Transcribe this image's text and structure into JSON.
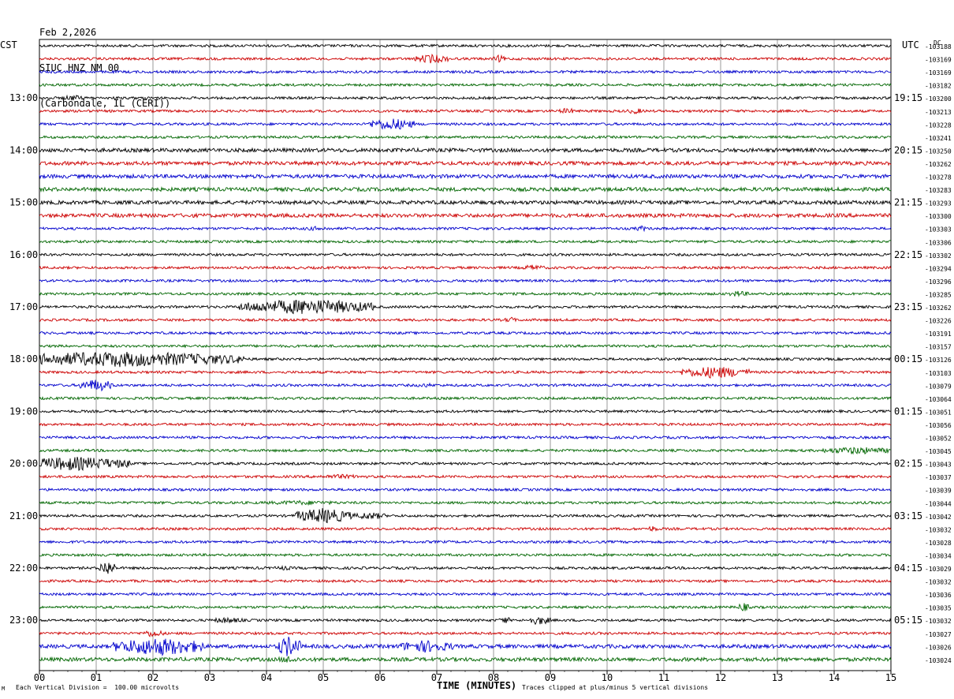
{
  "header": {
    "date": "Feb 2,2026",
    "station": "SIUC HNZ NM 00",
    "location": "(Carbondale, IL (CERI))"
  },
  "left_tz": "CST",
  "right_tz": "UTC",
  "dc_label": "DC",
  "footer": {
    "left": "Each Vertical Division =  100.00 microvolts",
    "xlabel": "TIME (MINUTES)",
    "right": "Traces clipped at plus/minus 5 vertical divisions",
    "corner": "M"
  },
  "colors": {
    "trace_cycle": [
      "#000000",
      "#cc0000",
      "#0000cc",
      "#006600"
    ],
    "grid": "#000000"
  },
  "chart_data": {
    "type": "line",
    "xlabel": "TIME (MINUTES)",
    "xlim": [
      0,
      15
    ],
    "x_ticks": [
      "00",
      "01",
      "02",
      "03",
      "04",
      "05",
      "06",
      "07",
      "08",
      "09",
      "10",
      "11",
      "12",
      "13",
      "14",
      "15"
    ],
    "left_hour_labels": [
      "13:00",
      "14:00",
      "15:00",
      "16:00",
      "17:00",
      "18:00",
      "19:00",
      "20:00",
      "21:00",
      "22:00",
      "23:00"
    ],
    "right_hour_labels": [
      "19:15",
      "20:15",
      "21:15",
      "22:15",
      "23:15",
      "00:15",
      "01:15",
      "02:15",
      "03:15",
      "04:15",
      "05:15"
    ],
    "dc_offsets": [
      "-103188",
      "-103169",
      "-103169",
      "-103182",
      "-103200",
      "-103213",
      "-103228",
      "-103241",
      "-103250",
      "-103262",
      "-103278",
      "-103283",
      "-103293",
      "-103300",
      "-103303",
      "-103306",
      "-103302",
      "-103294",
      "-103296",
      "-103285",
      "-103262",
      "-103226",
      "-103191",
      "-103157",
      "-103126",
      "-103103",
      "-103079",
      "-103064",
      "-103051",
      "-103056",
      "-103052",
      "-103045",
      "-103043",
      "-103037",
      "-103039",
      "-103044",
      "-103042",
      "-103032",
      "-103028",
      "-103034",
      "-103029",
      "-103032",
      "-103036",
      "-103035",
      "-103032",
      "-103027",
      "-103026",
      "-103024"
    ],
    "noise_level": [
      2,
      2,
      2,
      2,
      2,
      2,
      2,
      2,
      3,
      3,
      3,
      3,
      3,
      3,
      2,
      2,
      2,
      2,
      2,
      2,
      2,
      2,
      2,
      2,
      2,
      2,
      2,
      2,
      2,
      2,
      2,
      2,
      2,
      2,
      2,
      2,
      2,
      2,
      2,
      2,
      2,
      2,
      2,
      2,
      2,
      2,
      3,
      3
    ],
    "events": [
      {
        "trace": 1,
        "minute": 6.9,
        "amp": 6,
        "dur": 0.3
      },
      {
        "trace": 1,
        "minute": 8.1,
        "amp": 5,
        "dur": 0.1
      },
      {
        "trace": 4,
        "minute": 0.6,
        "amp": 4,
        "dur": 0.2
      },
      {
        "trace": 5,
        "minute": 9.3,
        "amp": 4,
        "dur": 0.15
      },
      {
        "trace": 5,
        "minute": 10.5,
        "amp": 4,
        "dur": 0.15
      },
      {
        "trace": 6,
        "minute": 6.2,
        "amp": 8,
        "dur": 0.4
      },
      {
        "trace": 9,
        "minute": 5.2,
        "amp": 3,
        "dur": 0.3
      },
      {
        "trace": 14,
        "minute": 4.9,
        "amp": 3,
        "dur": 0.3
      },
      {
        "trace": 14,
        "minute": 10.6,
        "amp": 4,
        "dur": 0.1
      },
      {
        "trace": 17,
        "minute": 8.7,
        "amp": 4,
        "dur": 0.2
      },
      {
        "trace": 19,
        "minute": 12.3,
        "amp": 4,
        "dur": 0.2
      },
      {
        "trace": 20,
        "minute": 4.7,
        "amp": 10,
        "dur": 1.2
      },
      {
        "trace": 21,
        "minute": 8.3,
        "amp": 4,
        "dur": 0.1
      },
      {
        "trace": 24,
        "minute": 1.4,
        "amp": 10,
        "dur": 2.2
      },
      {
        "trace": 25,
        "minute": 11.9,
        "amp": 8,
        "dur": 0.6
      },
      {
        "trace": 26,
        "minute": 1.0,
        "amp": 8,
        "dur": 0.3
      },
      {
        "trace": 26,
        "minute": 6.8,
        "amp": 3,
        "dur": 0.2
      },
      {
        "trace": 31,
        "minute": 14.4,
        "amp": 5,
        "dur": 0.6
      },
      {
        "trace": 32,
        "minute": 0.6,
        "amp": 9,
        "dur": 1.0
      },
      {
        "trace": 33,
        "minute": 5.3,
        "amp": 3,
        "dur": 0.6
      },
      {
        "trace": 35,
        "minute": 4.6,
        "amp": 3,
        "dur": 0.8
      },
      {
        "trace": 36,
        "minute": 5.0,
        "amp": 10,
        "dur": 0.5
      },
      {
        "trace": 36,
        "minute": 5.8,
        "amp": 5,
        "dur": 0.3
      },
      {
        "trace": 37,
        "minute": 10.8,
        "amp": 4,
        "dur": 0.1
      },
      {
        "trace": 40,
        "minute": 1.2,
        "amp": 10,
        "dur": 0.15
      },
      {
        "trace": 40,
        "minute": 4.3,
        "amp": 3,
        "dur": 0.2
      },
      {
        "trace": 43,
        "minute": 12.4,
        "amp": 6,
        "dur": 0.1
      },
      {
        "trace": 44,
        "minute": 3.3,
        "amp": 4,
        "dur": 0.3
      },
      {
        "trace": 44,
        "minute": 8.8,
        "amp": 6,
        "dur": 0.2
      },
      {
        "trace": 44,
        "minute": 8.2,
        "amp": 5,
        "dur": 0.1
      },
      {
        "trace": 45,
        "minute": 2.0,
        "amp": 5,
        "dur": 0.2
      },
      {
        "trace": 46,
        "minute": 2.1,
        "amp": 12,
        "dur": 0.8
      },
      {
        "trace": 46,
        "minute": 4.4,
        "amp": 14,
        "dur": 0.2
      },
      {
        "trace": 46,
        "minute": 6.8,
        "amp": 8,
        "dur": 0.5
      },
      {
        "trace": 46,
        "minute": 1.6,
        "amp": 8,
        "dur": 0.3
      },
      {
        "trace": 47,
        "minute": 4.4,
        "amp": 5,
        "dur": 0.2
      }
    ]
  }
}
